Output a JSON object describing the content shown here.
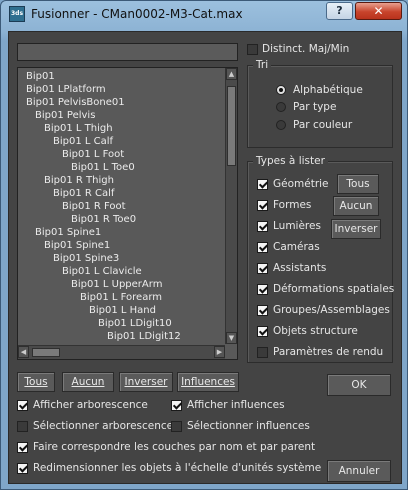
{
  "window": {
    "title": "Fusionner - CMan0002-M3-Cat.max",
    "app_icon": "3ds",
    "help_label": "?",
    "close_label": "✕"
  },
  "search": {
    "value": ""
  },
  "tree": {
    "items": [
      {
        "label": "Bip01",
        "depth": 0
      },
      {
        "label": "Bip01 LPlatform",
        "depth": 0
      },
      {
        "label": "Bip01 PelvisBone01",
        "depth": 0
      },
      {
        "label": "Bip01 Pelvis",
        "depth": 1
      },
      {
        "label": "Bip01 L Thigh",
        "depth": 2
      },
      {
        "label": "Bip01 L Calf",
        "depth": 3
      },
      {
        "label": "Bip01 L Foot",
        "depth": 4
      },
      {
        "label": "Bip01 L Toe0",
        "depth": 5
      },
      {
        "label": "Bip01 R Thigh",
        "depth": 2
      },
      {
        "label": "Bip01 R Calf",
        "depth": 3
      },
      {
        "label": "Bip01 R Foot",
        "depth": 4
      },
      {
        "label": "Bip01 R Toe0",
        "depth": 5
      },
      {
        "label": "Bip01 Spine1",
        "depth": 1
      },
      {
        "label": "Bip01 Spine1",
        "depth": 2
      },
      {
        "label": "Bip01 Spine3",
        "depth": 3
      },
      {
        "label": "Bip01 L Clavicle",
        "depth": 4
      },
      {
        "label": "Bip01 L UpperArm",
        "depth": 5
      },
      {
        "label": "Bip01 L Forearm",
        "depth": 6
      },
      {
        "label": "Bip01 L Hand",
        "depth": 7
      },
      {
        "label": "Bip01 LDigit10",
        "depth": 8
      },
      {
        "label": "Bip01 LDigit12",
        "depth": 9
      }
    ]
  },
  "case_sensitive": {
    "label": "Distinct. Maj/Min",
    "checked": false
  },
  "sort": {
    "title": "Tri",
    "options": [
      {
        "label": "Alphabétique",
        "selected": true
      },
      {
        "label": "Par type",
        "selected": false
      },
      {
        "label": "Par couleur",
        "selected": false
      }
    ]
  },
  "types": {
    "title": "Types à lister",
    "items": [
      {
        "label": "Géométrie",
        "checked": true
      },
      {
        "label": "Formes",
        "checked": true
      },
      {
        "label": "Lumières",
        "checked": true
      },
      {
        "label": "Caméras",
        "checked": true
      },
      {
        "label": "Assistants",
        "checked": true
      },
      {
        "label": "Déformations spatiales",
        "checked": true
      },
      {
        "label": "Groupes/Assemblages",
        "checked": true
      },
      {
        "label": "Objets structure",
        "checked": true
      },
      {
        "label": "Paramètres de rendu",
        "checked": false
      }
    ],
    "all_label": "Tous",
    "none_label": "Aucun",
    "invert_label": "Inverser"
  },
  "list_buttons": {
    "all": "Tous",
    "none": "Aucun",
    "invert": "Inverser",
    "influences": "Influences"
  },
  "options": {
    "show_tree": {
      "label": "Afficher arborescence",
      "checked": true
    },
    "show_influences": {
      "label": "Afficher influences",
      "checked": true
    },
    "select_tree": {
      "label": "Sélectionner arborescence",
      "checked": false
    },
    "select_influences": {
      "label": "Sélectionner influences",
      "checked": false
    },
    "match_layers": {
      "label": "Faire correspondre les couches par nom et par parent",
      "checked": true
    },
    "rescale": {
      "label": "Redimensionner les objets à l'échelle d'unités système",
      "checked": true
    }
  },
  "ok_label": "OK",
  "cancel_label": "Annuler"
}
